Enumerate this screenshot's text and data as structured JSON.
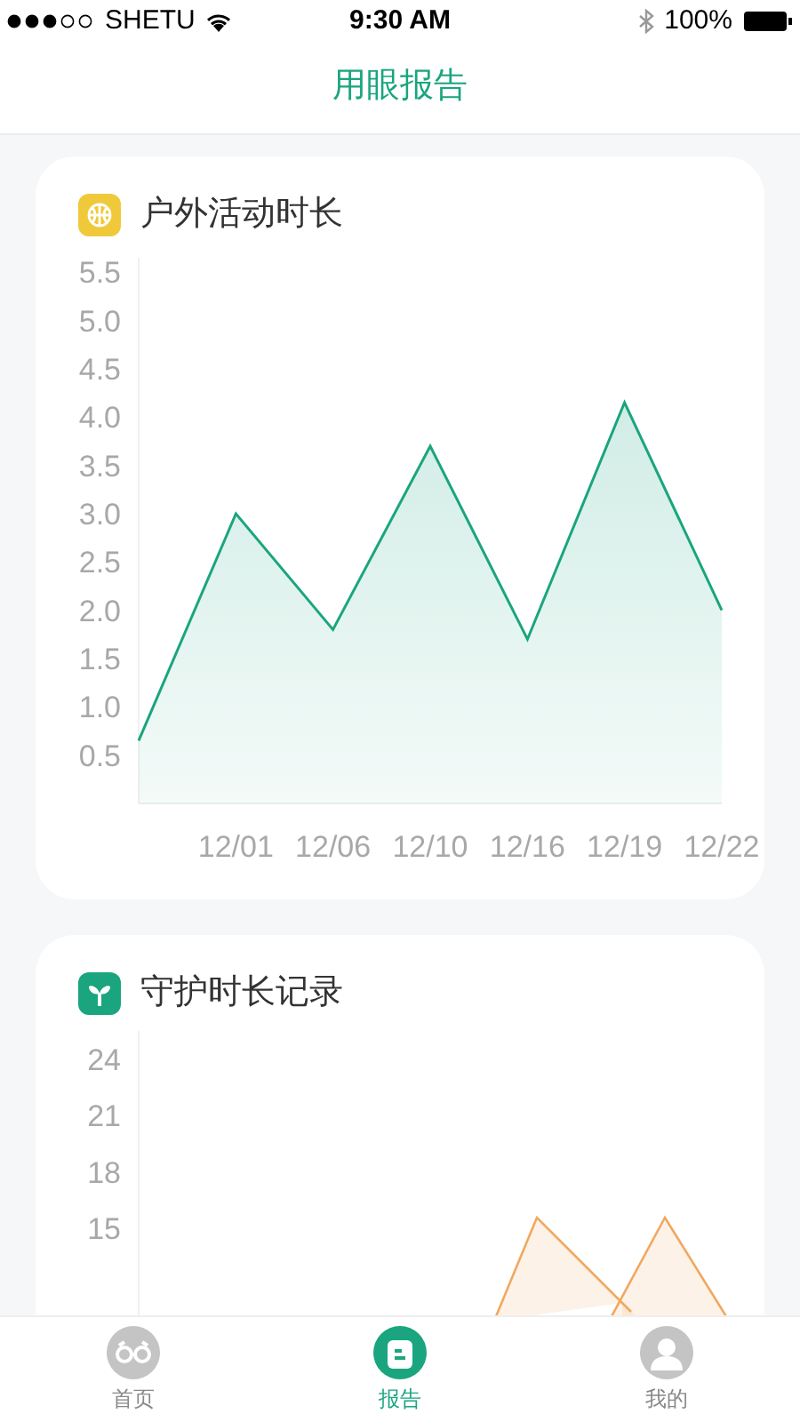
{
  "status_bar": {
    "carrier": "SHETU",
    "time": "9:30 AM",
    "battery": "100%"
  },
  "nav": {
    "title": "用眼报告"
  },
  "cards": [
    {
      "title": "户外活动时长",
      "chart_data": {
        "type": "area",
        "categories": [
          null,
          "12/01",
          "12/06",
          "12/10",
          "12/16",
          "12/19",
          "12/22"
        ],
        "series": [
          {
            "color": "#1aa57f",
            "values": [
              0.65,
              3.0,
              1.8,
              3.7,
              1.7,
              4.15,
              2.0
            ]
          }
        ],
        "ylim": [
          0,
          5.65
        ],
        "yticks": [
          0.5,
          {
            "value": 1,
            "label": "1.0"
          },
          1.5,
          {
            "value": 2,
            "label": "2.0"
          },
          2.5,
          {
            "value": 3,
            "label": "3.0"
          },
          3.5,
          {
            "value": 4,
            "label": "4.0"
          },
          4.5,
          {
            "value": 5,
            "label": "5.0"
          },
          5.5
        ]
      }
    },
    {
      "title": "守护时长记录",
      "axis_labels": [
        "24",
        "21",
        "18",
        "15"
      ]
    }
  ],
  "tabs": [
    {
      "label": "首页",
      "selected": false
    },
    {
      "label": "报告",
      "selected": true
    },
    {
      "label": "我的",
      "selected": false
    }
  ]
}
